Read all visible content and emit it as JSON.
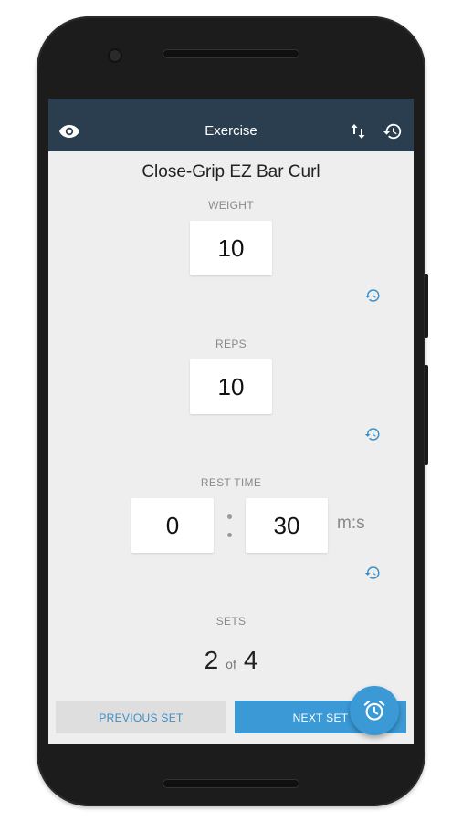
{
  "appbar": {
    "title": "Exercise",
    "icons": {
      "left": "eye-icon",
      "swap": "swap-vertical-icon",
      "history": "history-icon"
    }
  },
  "exercise": {
    "name": "Close-Grip EZ Bar Curl"
  },
  "weight": {
    "label": "WEIGHT",
    "value": "10"
  },
  "reps": {
    "label": "REPS",
    "value": "10"
  },
  "rest": {
    "label": "REST TIME",
    "minutes": "0",
    "seconds": "30",
    "unit": "m:s"
  },
  "sets": {
    "label": "SETS",
    "current": "2",
    "of": "of",
    "total": "4"
  },
  "buttons": {
    "previous": "PREVIOUS SET",
    "next": "NEXT SET"
  },
  "fab": {
    "icon": "alarm-clock-icon"
  },
  "colors": {
    "appbar": "#2b3e50",
    "accent": "#3b99d6",
    "background": "#eeeeee"
  }
}
